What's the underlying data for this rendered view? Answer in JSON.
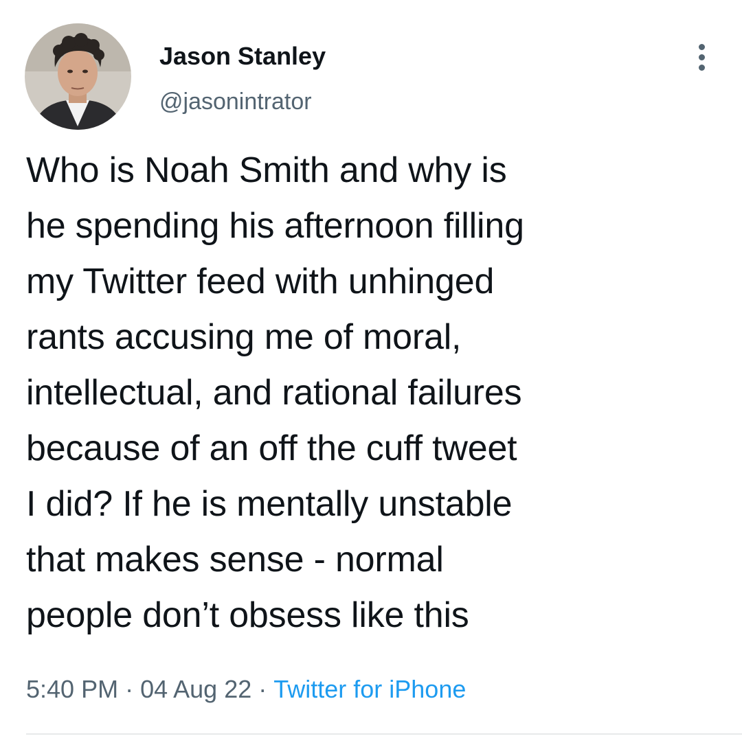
{
  "author": {
    "display_name": "Jason Stanley",
    "handle": "@jasonintrator"
  },
  "tweet": {
    "lines": [
      "Who is Noah Smith and why is",
      "he spending his afternoon filling",
      "my Twitter feed with unhinged",
      "rants accusing me of moral,",
      "intellectual, and rational failures",
      "because of an off the cuff tweet",
      "I did? If he is mentally unstable",
      "that makes sense - normal",
      "people don’t obsess like this"
    ]
  },
  "meta": {
    "time": "5:40 PM",
    "separator": "·",
    "date": "04 Aug 22",
    "source": "Twitter for iPhone"
  },
  "icons": {
    "menu": "more-vertical-icon"
  },
  "colors": {
    "text": "#0f1419",
    "secondary": "#536471",
    "link": "#1d9bf0",
    "divider": "#e7e9ea"
  }
}
